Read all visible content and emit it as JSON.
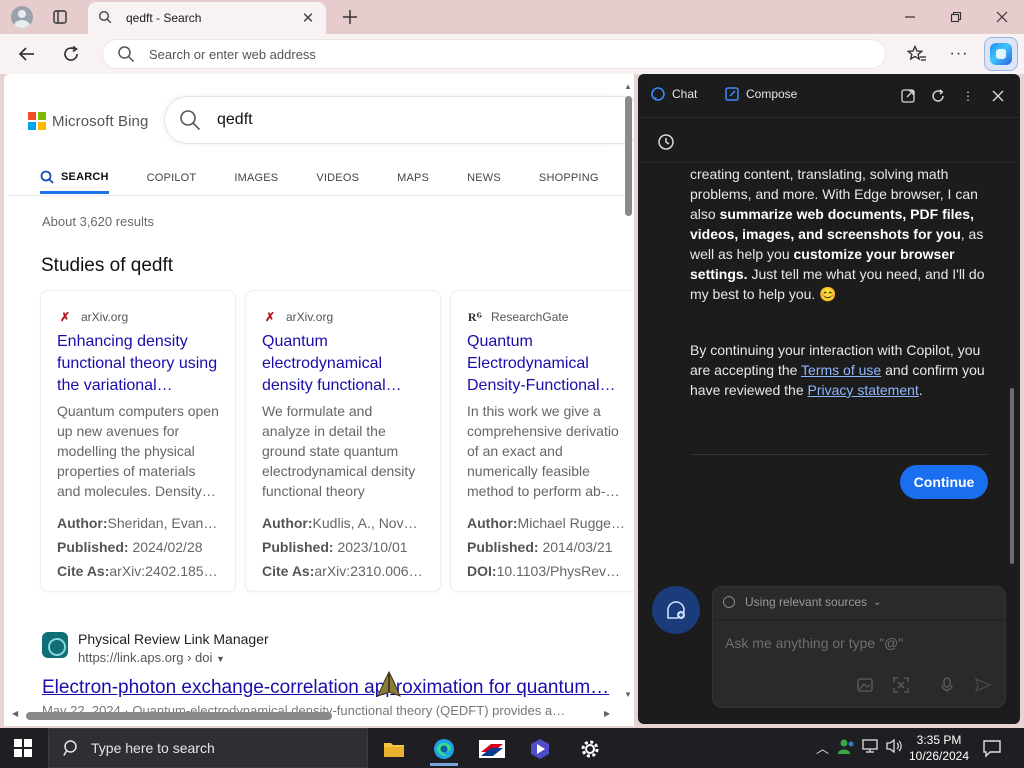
{
  "browser": {
    "tab": {
      "title": "qedft - Search"
    },
    "address": {
      "placeholder": "Search or enter web address"
    }
  },
  "bing": {
    "brand": "Microsoft Bing",
    "query": "qedft",
    "scopes": [
      "SEARCH",
      "COPILOT",
      "IMAGES",
      "VIDEOS",
      "MAPS",
      "NEWS",
      "SHOPPING"
    ],
    "result_count": "About 3,620 results",
    "studies_title": "Studies of qedft",
    "cards": [
      {
        "source": "arXiv.org",
        "title": "Enhancing density functional theory using the variational…",
        "snippet": "Quantum computers open up new avenues for modelling the physical properties of materials and molecules. Density…",
        "meta": [
          {
            "label": "Author:",
            "value": "Sheridan, Evan, …"
          },
          {
            "label": "Published:",
            "value": " 2024/02/28"
          },
          {
            "label": "Cite As:",
            "value": "arXiv:2402.185…"
          }
        ]
      },
      {
        "source": "arXiv.org",
        "title": "Quantum electrodynamical density functional…",
        "snippet": "We formulate and analyze in detail the ground state quantum electrodynamical density functional theory (QEDF…",
        "meta": [
          {
            "label": "Author:",
            "value": "Kudlis, A., Novo…"
          },
          {
            "label": "Published:",
            "value": " 2023/10/01"
          },
          {
            "label": "Cite As:",
            "value": "arXiv:2310.006…"
          }
        ]
      },
      {
        "source": "ResearchGate",
        "title": "Quantum Electrodynamical Density-Functional…",
        "snippet": "In this work we give a comprehensive derivatio of an exact and numerically feasible method to perform ab-…",
        "meta": [
          {
            "label": "Author:",
            "value": "Michael Ruggen…"
          },
          {
            "label": "Published:",
            "value": " 2014/03/21"
          },
          {
            "label": "DOI:",
            "value": "10.1103/PhysRevA…"
          }
        ]
      }
    ],
    "result": {
      "site_name": "Physical Review Link Manager",
      "url": "https://link.aps.org › doi",
      "title": "Electron-photon exchange-correlation approximation for quantum…",
      "snippet": "May 22, 2024 · Quantum-electrodynamical density-functional theory (QEDFT) provides a…"
    }
  },
  "copilot": {
    "tabs": {
      "chat": "Chat",
      "compose": "Compose"
    },
    "message_parts": [
      {
        "t": "creating content, translating, solving math problems, and more. With Edge browser, I can also ",
        "b": false
      },
      {
        "t": "summarize web documents, PDF files, videos, images, and screenshots for you",
        "b": true
      },
      {
        "t": ", as well as help you ",
        "b": false
      },
      {
        "t": "customize your browser settings.",
        "b": true
      },
      {
        "t": " Just tell me what you need, and I'll do my best to help you. 😊",
        "b": false
      }
    ],
    "notice": {
      "pre": "By continuing your interaction with Copilot, you are accepting the ",
      "terms": "Terms of use",
      "mid": " and confirm you have reviewed the ",
      "privacy": "Privacy statement",
      "post": "."
    },
    "continue_label": "Continue",
    "sources_label": "Using relevant sources",
    "input_placeholder": "Ask me anything or type \"@\""
  },
  "taskbar": {
    "search_placeholder": "Type here to search",
    "time": "3:35 PM",
    "date": "10/26/2024"
  },
  "colors": {
    "ms_red": "#f25022",
    "ms_green": "#7fba00",
    "ms_blue": "#00a4ef",
    "ms_yellow": "#ffb900",
    "link": "#1a0dab",
    "copilot_accent": "#1a6ef0"
  }
}
